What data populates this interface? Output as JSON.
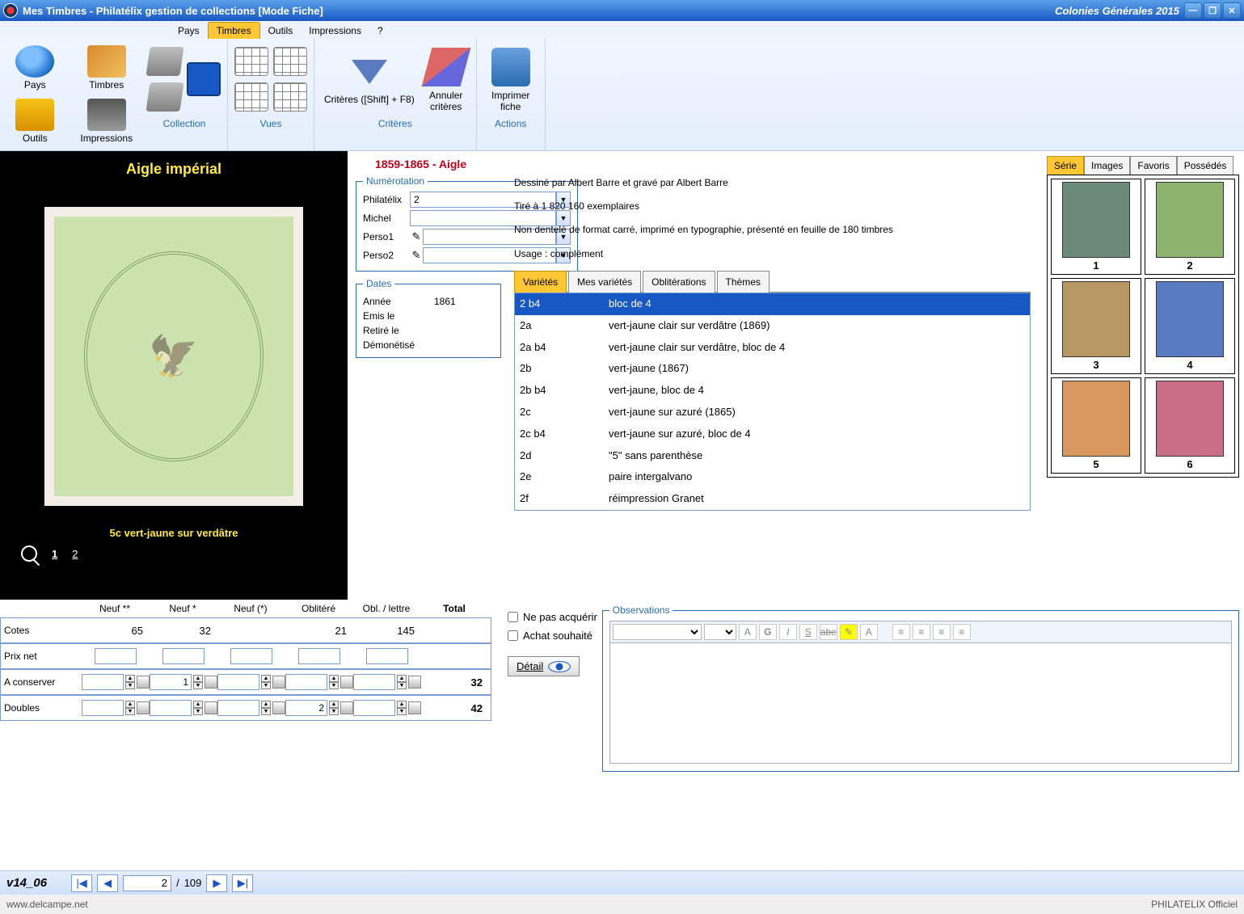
{
  "titlebar": {
    "app_title": "Mes Timbres - Philatélix gestion de collections [Mode Fiche]",
    "collection_name": "Colonies Générales 2015"
  },
  "menubar": {
    "items": [
      "Pays",
      "Timbres",
      "Outils",
      "Impressions",
      "?"
    ],
    "active": 1
  },
  "left_toolbar": {
    "pays": "Pays",
    "timbres": "Timbres",
    "outils": "Outils",
    "impressions": "Impressions"
  },
  "ribbon": {
    "groups": {
      "collection": "Collection",
      "vues": "Vues",
      "criteres": {
        "title": "Critères",
        "criteres_btn": "Critères ([Shift] + F8)",
        "annuler_btn": "Annuler critères"
      },
      "actions": {
        "title": "Actions",
        "imprimer_btn": "Imprimer fiche"
      }
    }
  },
  "stamp": {
    "title": "Aigle impérial",
    "caption": "5c vert-jaune sur verdâtre",
    "pages": [
      "1",
      "2"
    ],
    "active_page": 0
  },
  "series": {
    "name": "1859-1865 - Aigle"
  },
  "numbering": {
    "legend": "Numérotation",
    "philatelix_label": "Philatélix",
    "philatelix_value": "2",
    "michel_label": "Michel",
    "michel_value": "",
    "perso1_label": "Perso1",
    "perso1_value": "",
    "perso2_label": "Perso2",
    "perso2_value": ""
  },
  "description": {
    "line1": "Dessiné par Albert Barre et gravé par Albert Barre",
    "line2": "Tiré à 1 820 160 exemplaires",
    "line3": "Non dentelé de format carré, imprimé en typographie, présenté en feuille de 180 timbres",
    "line4": "Usage : complément"
  },
  "dates": {
    "legend": "Dates",
    "annee_label": "Année",
    "annee_value": "1861",
    "emis_label": "Emis le",
    "retire_label": "Retiré le",
    "demonetise_label": "Démonétisé"
  },
  "subtabs": {
    "items": [
      "Variétés",
      "Mes variétés",
      "Oblitérations",
      "Thèmes"
    ],
    "active": 0
  },
  "varieties": [
    {
      "code": "2 b4",
      "label": "bloc de 4"
    },
    {
      "code": "2a",
      "label": "vert-jaune clair sur verdâtre (1869)"
    },
    {
      "code": "2a b4",
      "label": "vert-jaune clair sur verdâtre, bloc de 4"
    },
    {
      "code": "2b",
      "label": "vert-jaune (1867)"
    },
    {
      "code": "2b b4",
      "label": "vert-jaune, bloc de 4"
    },
    {
      "code": "2c",
      "label": "vert-jaune sur azuré (1865)"
    },
    {
      "code": "2c b4",
      "label": "vert-jaune sur azuré, bloc de 4"
    },
    {
      "code": "2d",
      "label": "\"5\" sans parenthèse"
    },
    {
      "code": "2e",
      "label": "paire intergalvano"
    },
    {
      "code": "2f",
      "label": "réimpression Granet"
    }
  ],
  "series_tabs": {
    "items": [
      "Série",
      "Images",
      "Favoris",
      "Possédés"
    ],
    "active": 0
  },
  "thumbs": [
    {
      "label": "1",
      "color": "#6b8a7a"
    },
    {
      "label": "2",
      "color": "#8eb36f"
    },
    {
      "label": "3",
      "color": "#b89862"
    },
    {
      "label": "4",
      "color": "#5a7bbf"
    },
    {
      "label": "5",
      "color": "#d89860"
    },
    {
      "label": "6",
      "color": "#c97088"
    }
  ],
  "prices": {
    "headers": {
      "neuf2": "Neuf **",
      "neuf1": "Neuf *",
      "neufp": "Neuf (*)",
      "oblitere": "Oblitéré",
      "obl_lettre": "Obl. / lettre",
      "total": "Total"
    },
    "rows": {
      "cotes": {
        "label": "Cotes",
        "neuf2": "65",
        "neuf1": "32",
        "neufp": "",
        "oblitere": "21",
        "obl_lettre": "145",
        "total": ""
      },
      "prix_net": {
        "label": "Prix net"
      },
      "a_conserver": {
        "label": "A conserver",
        "neuf2": "",
        "neuf1": "1",
        "neufp": "",
        "oblitere": "",
        "obl_lettre": "",
        "total": "32"
      },
      "doubles": {
        "label": "Doubles",
        "neuf2": "",
        "neuf1": "",
        "neufp": "",
        "oblitere": "2",
        "obl_lettre": "",
        "total": "42"
      }
    }
  },
  "acquisition": {
    "ne_pas_acquerir": "Ne pas acquérir",
    "achat_souhaite": "Achat souhaité",
    "detail_btn": "Détail"
  },
  "observations": {
    "legend": "Observations"
  },
  "navigation": {
    "position": "2",
    "total": "109",
    "separator": "/"
  },
  "version": "v14_06",
  "footer": {
    "left": "www.delcampe.net",
    "right": "PHILATELIX Officiel"
  }
}
